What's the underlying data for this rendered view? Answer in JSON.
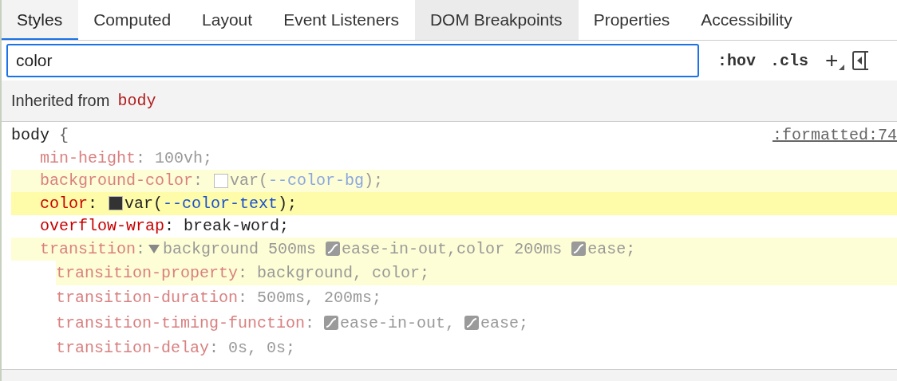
{
  "tabs": [
    {
      "label": "Styles",
      "selected": true,
      "hovered": false
    },
    {
      "label": "Computed",
      "selected": false,
      "hovered": false
    },
    {
      "label": "Layout",
      "selected": false,
      "hovered": false
    },
    {
      "label": "Event Listeners",
      "selected": false,
      "hovered": false
    },
    {
      "label": "DOM Breakpoints",
      "selected": false,
      "hovered": true
    },
    {
      "label": "Properties",
      "selected": false,
      "hovered": false
    },
    {
      "label": "Accessibility",
      "selected": false,
      "hovered": false
    }
  ],
  "filter": {
    "value": "color"
  },
  "toolbar": {
    "buttons": [
      ":hov",
      ".cls",
      "+"
    ]
  },
  "inherited": {
    "label": "Inherited from",
    "selector": "body"
  },
  "rule": {
    "selector": "body",
    "brace": "{",
    "source": ":formatted:74",
    "properties": [
      {
        "name": "min-height",
        "dimmed": true,
        "matched": false,
        "active": false,
        "value": [
          {
            "kind": "text",
            "text": ": 100vh;"
          }
        ]
      },
      {
        "name": "background-color",
        "dimmed": true,
        "matched": true,
        "active": false,
        "value": [
          {
            "kind": "text",
            "text": ": "
          },
          {
            "kind": "swatch",
            "color": "#ffffff"
          },
          {
            "kind": "text",
            "text": "var("
          },
          {
            "kind": "var",
            "text": "--color-bg"
          },
          {
            "kind": "text",
            "text": ");"
          }
        ]
      },
      {
        "name": "color",
        "dimmed": false,
        "matched": true,
        "active": true,
        "value": [
          {
            "kind": "text",
            "text": ": "
          },
          {
            "kind": "swatch",
            "color": "#333333"
          },
          {
            "kind": "text",
            "text": "var("
          },
          {
            "kind": "var",
            "text": "--color-text"
          },
          {
            "kind": "text",
            "text": ");"
          }
        ]
      },
      {
        "name": "overflow-wrap",
        "dimmed": false,
        "matched": false,
        "active": false,
        "value": [
          {
            "kind": "text",
            "text": ": break-word;"
          }
        ]
      },
      {
        "name": "transition",
        "dimmed": true,
        "matched": true,
        "active": false,
        "value": [
          {
            "kind": "text",
            "text": ":"
          },
          {
            "kind": "expander",
            "expanded": true
          },
          {
            "kind": "text",
            "text": "background 500ms "
          },
          {
            "kind": "easing"
          },
          {
            "kind": "text",
            "text": "ease-in-out,color 200ms "
          },
          {
            "kind": "easing"
          },
          {
            "kind": "text",
            "text": "ease;"
          }
        ],
        "children": [
          {
            "name": "transition-property",
            "dimmed": true,
            "matched": true,
            "active": false,
            "value": [
              {
                "kind": "text",
                "text": ": background, color;"
              }
            ]
          },
          {
            "name": "transition-duration",
            "dimmed": true,
            "matched": false,
            "active": false,
            "value": [
              {
                "kind": "text",
                "text": ": 500ms, 200ms;"
              }
            ]
          },
          {
            "name": "transition-timing-function",
            "dimmed": true,
            "matched": false,
            "active": false,
            "value": [
              {
                "kind": "text",
                "text": ": "
              },
              {
                "kind": "easing"
              },
              {
                "kind": "text",
                "text": "ease-in-out, "
              },
              {
                "kind": "easing"
              },
              {
                "kind": "text",
                "text": "ease;"
              }
            ]
          },
          {
            "name": "transition-delay",
            "dimmed": true,
            "matched": false,
            "active": false,
            "value": [
              {
                "kind": "text",
                "text": ": 0s, 0s;"
              }
            ]
          }
        ]
      }
    ]
  }
}
